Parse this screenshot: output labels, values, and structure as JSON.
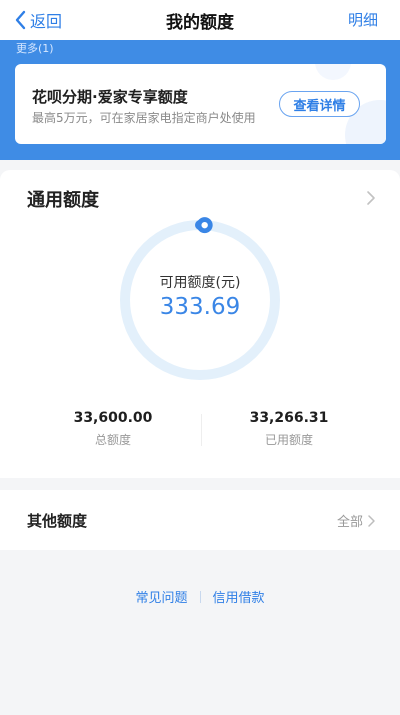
{
  "nav": {
    "back_label": "返回",
    "title": "我的额度",
    "detail_label": "明细"
  },
  "banner": {
    "more_label": "更多(1)",
    "promo_title": "花呗分期·爱家专享额度",
    "promo_subtitle": "最高5万元，可在家居家电指定商户处使用",
    "promo_button": "查看详情"
  },
  "general_quota": {
    "title": "通用额度",
    "available_label": "可用额度(元)",
    "available_value": "333.69",
    "total_value": "33,600.00",
    "total_label": "总额度",
    "used_value": "33,266.31",
    "used_label": "已用额度",
    "available_fraction": 0.0099
  },
  "other_quota": {
    "title": "其他额度",
    "all_label": "全部"
  },
  "footer": {
    "faq_label": "常见问题",
    "loan_label": "信用借款"
  },
  "colors": {
    "accent": "#2f7fe6",
    "banner_bg": "#3f8ce5",
    "ring_track": "#e3f0fb",
    "page_bg": "#f4f5f7"
  },
  "icons": {
    "back": "chevron-left-icon",
    "forward": "chevron-right-icon",
    "ring_handle": "progress-handle-icon"
  }
}
